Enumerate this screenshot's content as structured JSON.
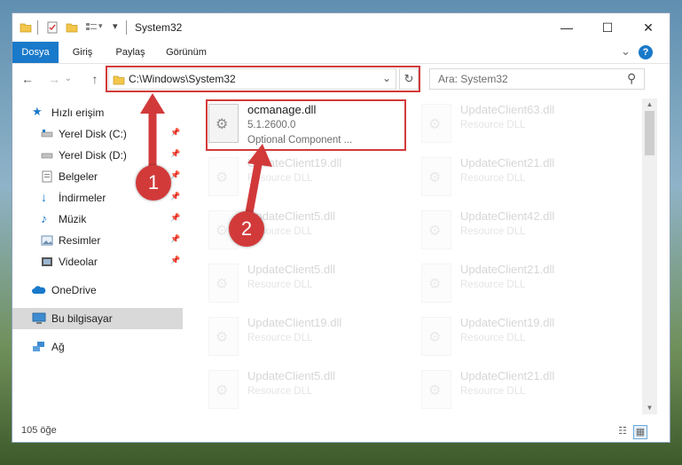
{
  "window": {
    "title": "System32"
  },
  "window_buttons": {
    "minimize": "—",
    "maximize": "☐",
    "close": "✕"
  },
  "ribbon": {
    "tabs": [
      "Dosya",
      "Giriş",
      "Paylaş",
      "Görünüm"
    ],
    "collapse": "⌄",
    "help": "?"
  },
  "nav": {
    "back": "←",
    "forward": "→",
    "up": "↑",
    "history": "⌄"
  },
  "address": {
    "path": "C:\\Windows\\System32",
    "dropdown": "⌄",
    "refresh": "↻"
  },
  "search": {
    "placeholder": "Ara: System32",
    "icon": "⚲"
  },
  "sidebar": {
    "items": [
      {
        "label": "Hızlı erişim",
        "icon": "star-icon",
        "pinned": false
      },
      {
        "label": "Yerel Disk (C:)",
        "icon": "drive-icon",
        "pinned": true
      },
      {
        "label": "Yerel Disk (D:)",
        "icon": "drive-icon",
        "pinned": true
      },
      {
        "label": "Belgeler",
        "icon": "documents-icon",
        "pinned": true
      },
      {
        "label": "İndirmeler",
        "icon": "download-icon",
        "pinned": true
      },
      {
        "label": "Müzik",
        "icon": "music-icon",
        "pinned": true
      },
      {
        "label": "Resimler",
        "icon": "pictures-icon",
        "pinned": true
      },
      {
        "label": "Videolar",
        "icon": "videos-icon",
        "pinned": true
      },
      {
        "label": "OneDrive",
        "icon": "cloud-icon",
        "pinned": false
      },
      {
        "label": "Bu bilgisayar",
        "icon": "computer-icon",
        "pinned": false
      },
      {
        "label": "Ağ",
        "icon": "network-icon",
        "pinned": false
      }
    ]
  },
  "files": [
    {
      "name": "ocmanage.dll",
      "line2": "5.1.2600.0",
      "line3": "Optional Component ...",
      "highlight": true
    },
    {
      "name": "UpdateClient63.dll",
      "line2": "Resource DLL"
    },
    {
      "name": "UpdateClient19.dll",
      "line2": "Resource DLL"
    },
    {
      "name": "UpdateClient21.dll",
      "line2": "Resource DLL"
    },
    {
      "name": "UpdateClient5.dll",
      "line2": "Resource DLL"
    },
    {
      "name": "UpdateClient42.dll",
      "line2": "Resource DLL"
    },
    {
      "name": "UpdateClient5.dll",
      "line2": "Resource DLL"
    },
    {
      "name": "UpdateClient21.dll",
      "line2": "Resource DLL"
    },
    {
      "name": "UpdateClient19.dll",
      "line2": "Resource DLL"
    },
    {
      "name": "UpdateClient19.dll",
      "line2": "Resource DLL"
    },
    {
      "name": "UpdateClient5.dll",
      "line2": "Resource DLL"
    },
    {
      "name": "UpdateClient21.dll",
      "line2": "Resource DLL"
    }
  ],
  "status": {
    "count": "105 öğe"
  },
  "annotations": {
    "badge1": "1",
    "badge2": "2"
  },
  "colors": {
    "accent": "#1979ca",
    "annotation": "#d23a3a",
    "folder": "#f3c64b"
  }
}
